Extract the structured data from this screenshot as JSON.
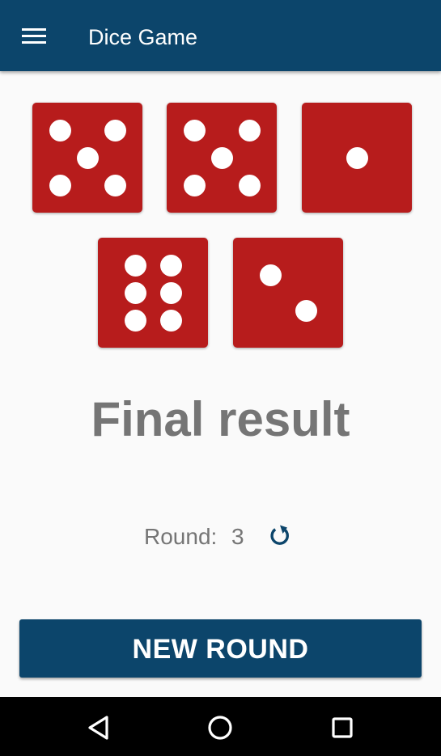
{
  "app_bar": {
    "title": "Dice Game",
    "menu_icon": "hamburger-menu-icon",
    "background": "#0c456b"
  },
  "dice": [
    {
      "value": 5
    },
    {
      "value": 5
    },
    {
      "value": 1
    },
    {
      "value": 6
    },
    {
      "value": 2
    }
  ],
  "dice_color": "#b71c1c",
  "result": {
    "text": "Final result"
  },
  "round": {
    "label": "Round:",
    "value": "3",
    "reset_icon": "reset-icon"
  },
  "actions": {
    "new_round_label": "NEW ROUND"
  },
  "nav_bar": {
    "back_icon": "back-icon",
    "home_icon": "home-icon",
    "recents_icon": "recents-icon"
  }
}
